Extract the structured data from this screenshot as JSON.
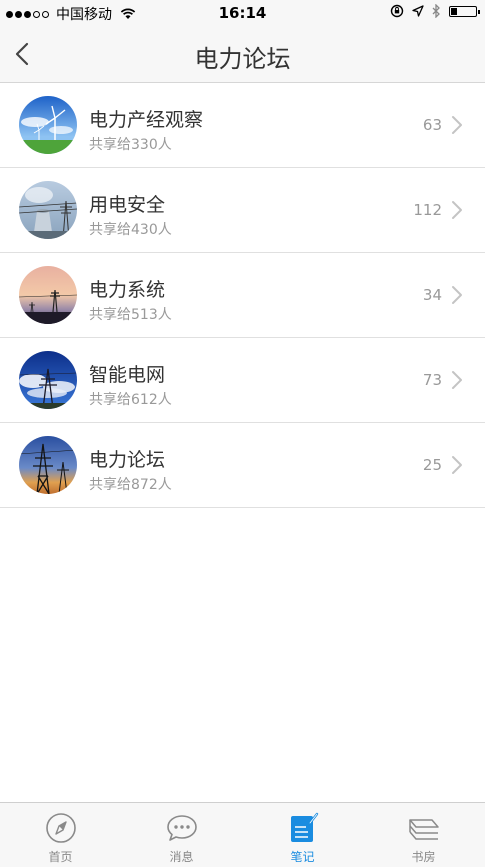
{
  "status_bar": {
    "carrier": "中国移动",
    "time": "16:14",
    "signal_bars_filled": 3,
    "signal_bars_total": 5,
    "battery_level": 0.25
  },
  "nav": {
    "title": "电力论坛",
    "back_icon": "chevron-left-icon"
  },
  "list": [
    {
      "title": "电力产经观察",
      "subtitle": "共享给330人",
      "count": "63",
      "image": "wind-turbine"
    },
    {
      "title": "用电安全",
      "subtitle": "共享给430人",
      "count": "112",
      "image": "cooling-tower"
    },
    {
      "title": "电力系统",
      "subtitle": "共享给513人",
      "count": "34",
      "image": "sunset-pylon"
    },
    {
      "title": "智能电网",
      "subtitle": "共享给612人",
      "count": "73",
      "image": "substation"
    },
    {
      "title": "电力论坛",
      "subtitle": "共享给872人",
      "count": "25",
      "image": "pylon-dusk"
    }
  ],
  "tabs": [
    {
      "label": "首页",
      "icon": "compass-icon",
      "active": false
    },
    {
      "label": "消息",
      "icon": "chat-bubble-icon",
      "active": false
    },
    {
      "label": "笔记",
      "icon": "note-edit-icon",
      "active": true
    },
    {
      "label": "书房",
      "icon": "books-stack-icon",
      "active": false
    }
  ],
  "colors": {
    "accent": "#1a8ce0",
    "bar_bg": "#f7f7f7",
    "secondary_text": "#999999"
  }
}
